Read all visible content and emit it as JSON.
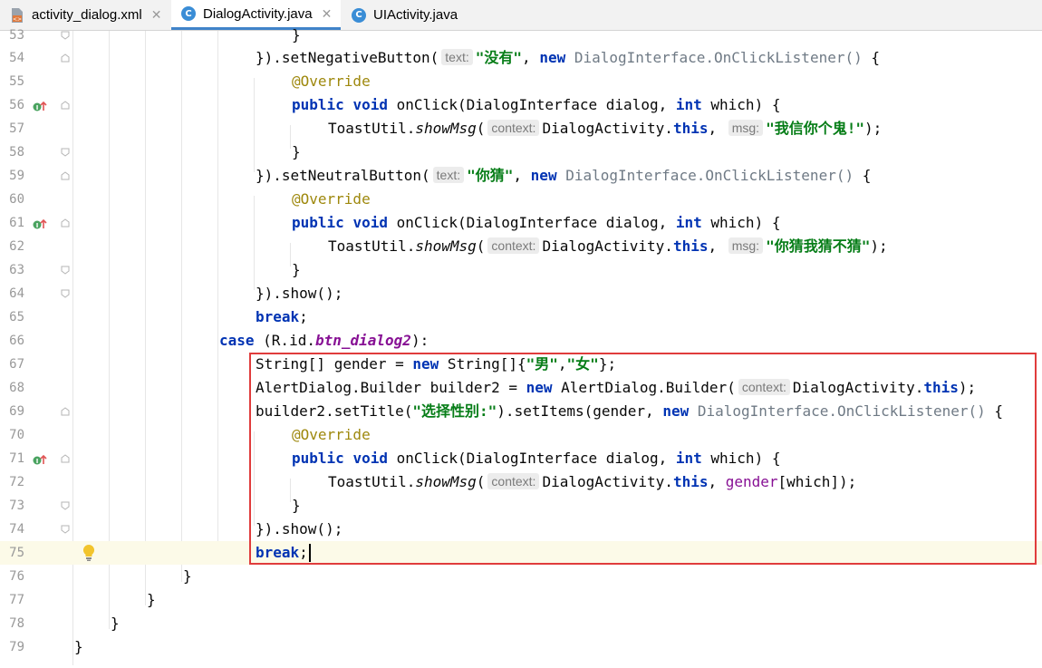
{
  "tabs": [
    {
      "label": "activity_dialog.xml",
      "icon": "xml-file-icon",
      "active": false
    },
    {
      "label": "DialogActivity.java",
      "icon": "java-class-icon",
      "active": true
    },
    {
      "label": "UIActivity.java",
      "icon": "java-class-icon",
      "active": false
    }
  ],
  "close_glyph": "✕",
  "accent_colors": {
    "keyword": "#0033b3",
    "string": "#067d17",
    "annotation": "#9e880d",
    "highlight_box": "#e03c3c",
    "active_tab": "#4083c9"
  },
  "lines": {
    "53": {
      "num": "53",
      "t": [
        "}"
      ]
    },
    "54": {
      "num": "54",
      "t": [
        "}).setNegativeButton(",
        "text:",
        "\"没有\"",
        ", ",
        "new",
        " DialogInterface.OnClickListener()",
        " {"
      ]
    },
    "55": {
      "num": "55",
      "t": [
        "@Override"
      ]
    },
    "56": {
      "num": "56",
      "t": [
        "public",
        " ",
        "void",
        " onClick(DialogInterface dialog, ",
        "int",
        " which) {"
      ]
    },
    "57": {
      "num": "57",
      "t": [
        "ToastUtil.",
        "showMsg",
        "(",
        "context:",
        "DialogActivity.",
        "this",
        ", ",
        "msg:",
        "\"我信你个鬼!\"",
        ");"
      ]
    },
    "58": {
      "num": "58",
      "t": [
        "}"
      ]
    },
    "59": {
      "num": "59",
      "t": [
        "}).setNeutralButton(",
        "text:",
        "\"你猜\"",
        ", ",
        "new",
        " DialogInterface.OnClickListener()",
        " {"
      ]
    },
    "60": {
      "num": "60",
      "t": [
        "@Override"
      ]
    },
    "61": {
      "num": "61",
      "t": [
        "public",
        " ",
        "void",
        " onClick(DialogInterface dialog, ",
        "int",
        " which) {"
      ]
    },
    "62": {
      "num": "62",
      "t": [
        "ToastUtil.",
        "showMsg",
        "(",
        "context:",
        "DialogActivity.",
        "this",
        ", ",
        "msg:",
        "\"你猜我猜不猜\"",
        ");"
      ]
    },
    "63": {
      "num": "63",
      "t": [
        "}"
      ]
    },
    "64": {
      "num": "64",
      "t": [
        "}).show();"
      ]
    },
    "65": {
      "num": "65",
      "t": [
        "break",
        ";"
      ]
    },
    "66": {
      "num": "66",
      "t": [
        "case",
        " (R.id.",
        "btn_dialog2",
        "):"
      ]
    },
    "67": {
      "num": "67",
      "t": [
        "String[] gender = ",
        "new",
        " String[]{",
        "\"男\"",
        ",",
        "\"女\"",
        "};"
      ]
    },
    "68": {
      "num": "68",
      "t": [
        "AlertDialog.Builder builder2 = ",
        "new",
        " AlertDialog.Builder(",
        "context:",
        "DialogActivity.",
        "this",
        ");"
      ]
    },
    "69": {
      "num": "69",
      "t": [
        "builder2.setTitle(",
        "\"选择性别:\"",
        ").setItems(gender, ",
        "new",
        " DialogInterface.OnClickListener()",
        " {"
      ]
    },
    "70": {
      "num": "70",
      "t": [
        "@Override"
      ]
    },
    "71": {
      "num": "71",
      "t": [
        "public",
        " ",
        "void",
        " onClick(DialogInterface dialog, ",
        "int",
        " which) {"
      ]
    },
    "72": {
      "num": "72",
      "t": [
        "ToastUtil.",
        "showMsg",
        "(",
        "context:",
        "DialogActivity.",
        "this",
        ", ",
        "gender",
        "[which]);"
      ]
    },
    "73": {
      "num": "73",
      "t": [
        "}"
      ]
    },
    "74": {
      "num": "74",
      "t": [
        "}).show();"
      ]
    },
    "75": {
      "num": "75",
      "t": [
        "break",
        ";"
      ]
    },
    "76": {
      "num": "76",
      "t": [
        "}"
      ]
    },
    "77": {
      "num": "77",
      "t": [
        "}"
      ]
    },
    "78": {
      "num": "78",
      "t": [
        "}"
      ]
    },
    "79": {
      "num": "79",
      "t": [
        "}"
      ]
    }
  }
}
